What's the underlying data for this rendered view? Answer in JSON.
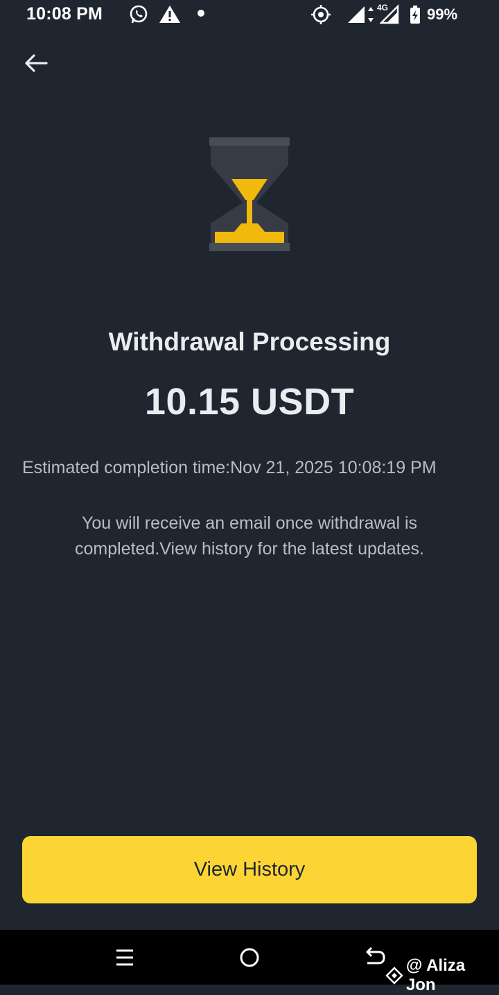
{
  "status_bar": {
    "time": "10:08 PM",
    "network": "4G",
    "battery": "99%",
    "icons": [
      "whatsapp-icon",
      "alert-icon",
      "dot-icon",
      "location-target-icon",
      "signal-icon",
      "signal-icon",
      "battery-icon"
    ]
  },
  "header": {
    "back_icon": "arrow-left-icon"
  },
  "main": {
    "illustration": "hourglass-icon",
    "title": "Withdrawal Processing",
    "amount": "10.15 USDT",
    "eta": "Estimated completion time:Nov 21, 2025 10:08:19 PM",
    "note": "You will receive an email once withdrawal is completed.View history for the latest updates."
  },
  "actions": {
    "view_history_label": "View History"
  },
  "nav_bar": {
    "icons": [
      "menu-icon",
      "home-icon",
      "back-icon"
    ]
  },
  "watermark": {
    "text": "@ Aliza Jon"
  },
  "colors": {
    "background": "#202630",
    "accent": "#FCD535",
    "text_primary": "#EAECEF",
    "text_secondary": "#B7BDC6"
  }
}
